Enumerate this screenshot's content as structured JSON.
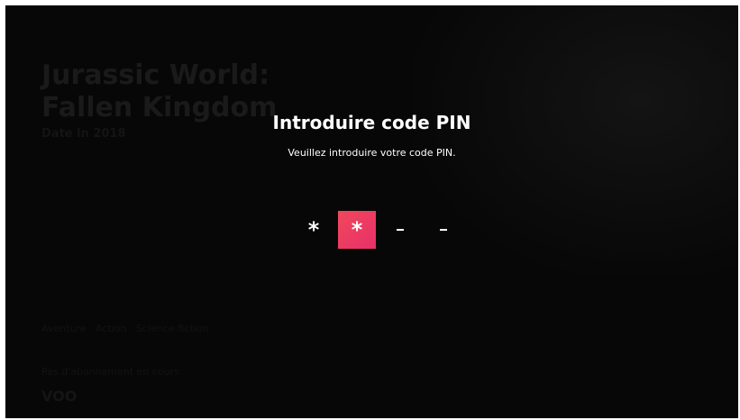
{
  "background": {
    "title": "Jurassic World: Fallen Kingdom",
    "subtitle": "Date in 2018",
    "meta": "Aventure · Action · Science-fiction",
    "bottom_text": "Pas d'abonnement en cours",
    "logo": "VOO"
  },
  "dialog": {
    "title": "Introduire code PIN",
    "subtitle": "Veuillez introduire votre code PIN."
  },
  "pin": {
    "digits": [
      {
        "state": "filled",
        "glyph": "*"
      },
      {
        "state": "active",
        "glyph": "*"
      },
      {
        "state": "empty",
        "glyph": ""
      },
      {
        "state": "empty",
        "glyph": ""
      }
    ]
  },
  "colors": {
    "accent_start": "#f0485a",
    "accent_end": "#e8306a",
    "overlay": "#070707"
  }
}
